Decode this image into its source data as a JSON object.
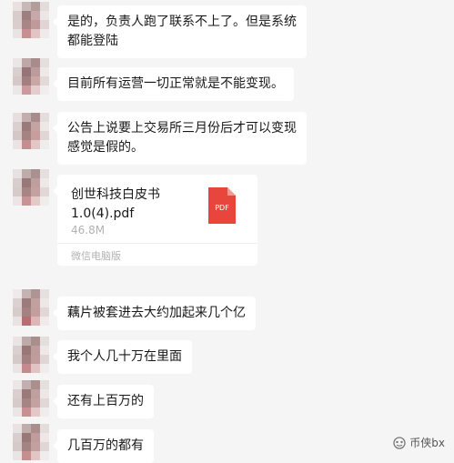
{
  "messages": [
    {
      "type": "text",
      "text": "是的，负责人跑了联系不上了。但是系统\n都能登陆"
    },
    {
      "type": "text",
      "text": "目前所有运营一切正常就是不能变现。"
    },
    {
      "type": "text",
      "text": "公告上说要上交易所三月份后才可以变现\n感觉是假的。"
    },
    {
      "type": "file",
      "file_name": "创世科技白皮书\n1.0(4).pdf",
      "file_size": "46.8M",
      "file_type": "PDF",
      "source": "微信电脑版",
      "icon": "pdf-file-icon"
    },
    {
      "type": "text",
      "text": "藕片被套进去大约加起来几个亿"
    },
    {
      "type": "text",
      "text": "我个人几十万在里面"
    },
    {
      "type": "text",
      "text": "还有上百万的"
    },
    {
      "type": "text",
      "text": "几百万的都有"
    }
  ],
  "watermark": {
    "text": "币侠bx",
    "icon": "wechat-channel-icon"
  },
  "colors": {
    "background": "#f5f5f5",
    "bubble": "#ffffff",
    "text": "#191919",
    "muted": "#b2b2b2",
    "pdf": "#e8453c"
  }
}
